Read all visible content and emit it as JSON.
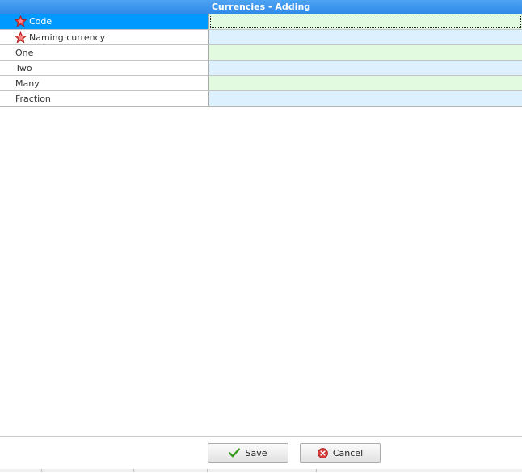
{
  "window": {
    "title": "Currencies - Adding"
  },
  "fields": [
    {
      "label": "Code",
      "required": true,
      "icon": "required-star-icon",
      "value": ""
    },
    {
      "label": "Naming currency",
      "required": true,
      "icon": "required-star-icon",
      "value": ""
    },
    {
      "label": "One",
      "required": false,
      "value": ""
    },
    {
      "label": "Two",
      "required": false,
      "value": ""
    },
    {
      "label": "Many",
      "required": false,
      "value": ""
    },
    {
      "label": "Fraction",
      "required": false,
      "value": ""
    }
  ],
  "buttons": {
    "save_label": "Save",
    "save_icon": "checkmark-icon",
    "cancel_label": "Cancel",
    "cancel_icon": "cancel-x-icon"
  },
  "colors": {
    "title_bar": "#2f8ae9",
    "selected_row": "#0099ff",
    "value_green": "#e1fae0",
    "value_blue": "#dcf0fd",
    "required_star": "#e83c3c"
  }
}
